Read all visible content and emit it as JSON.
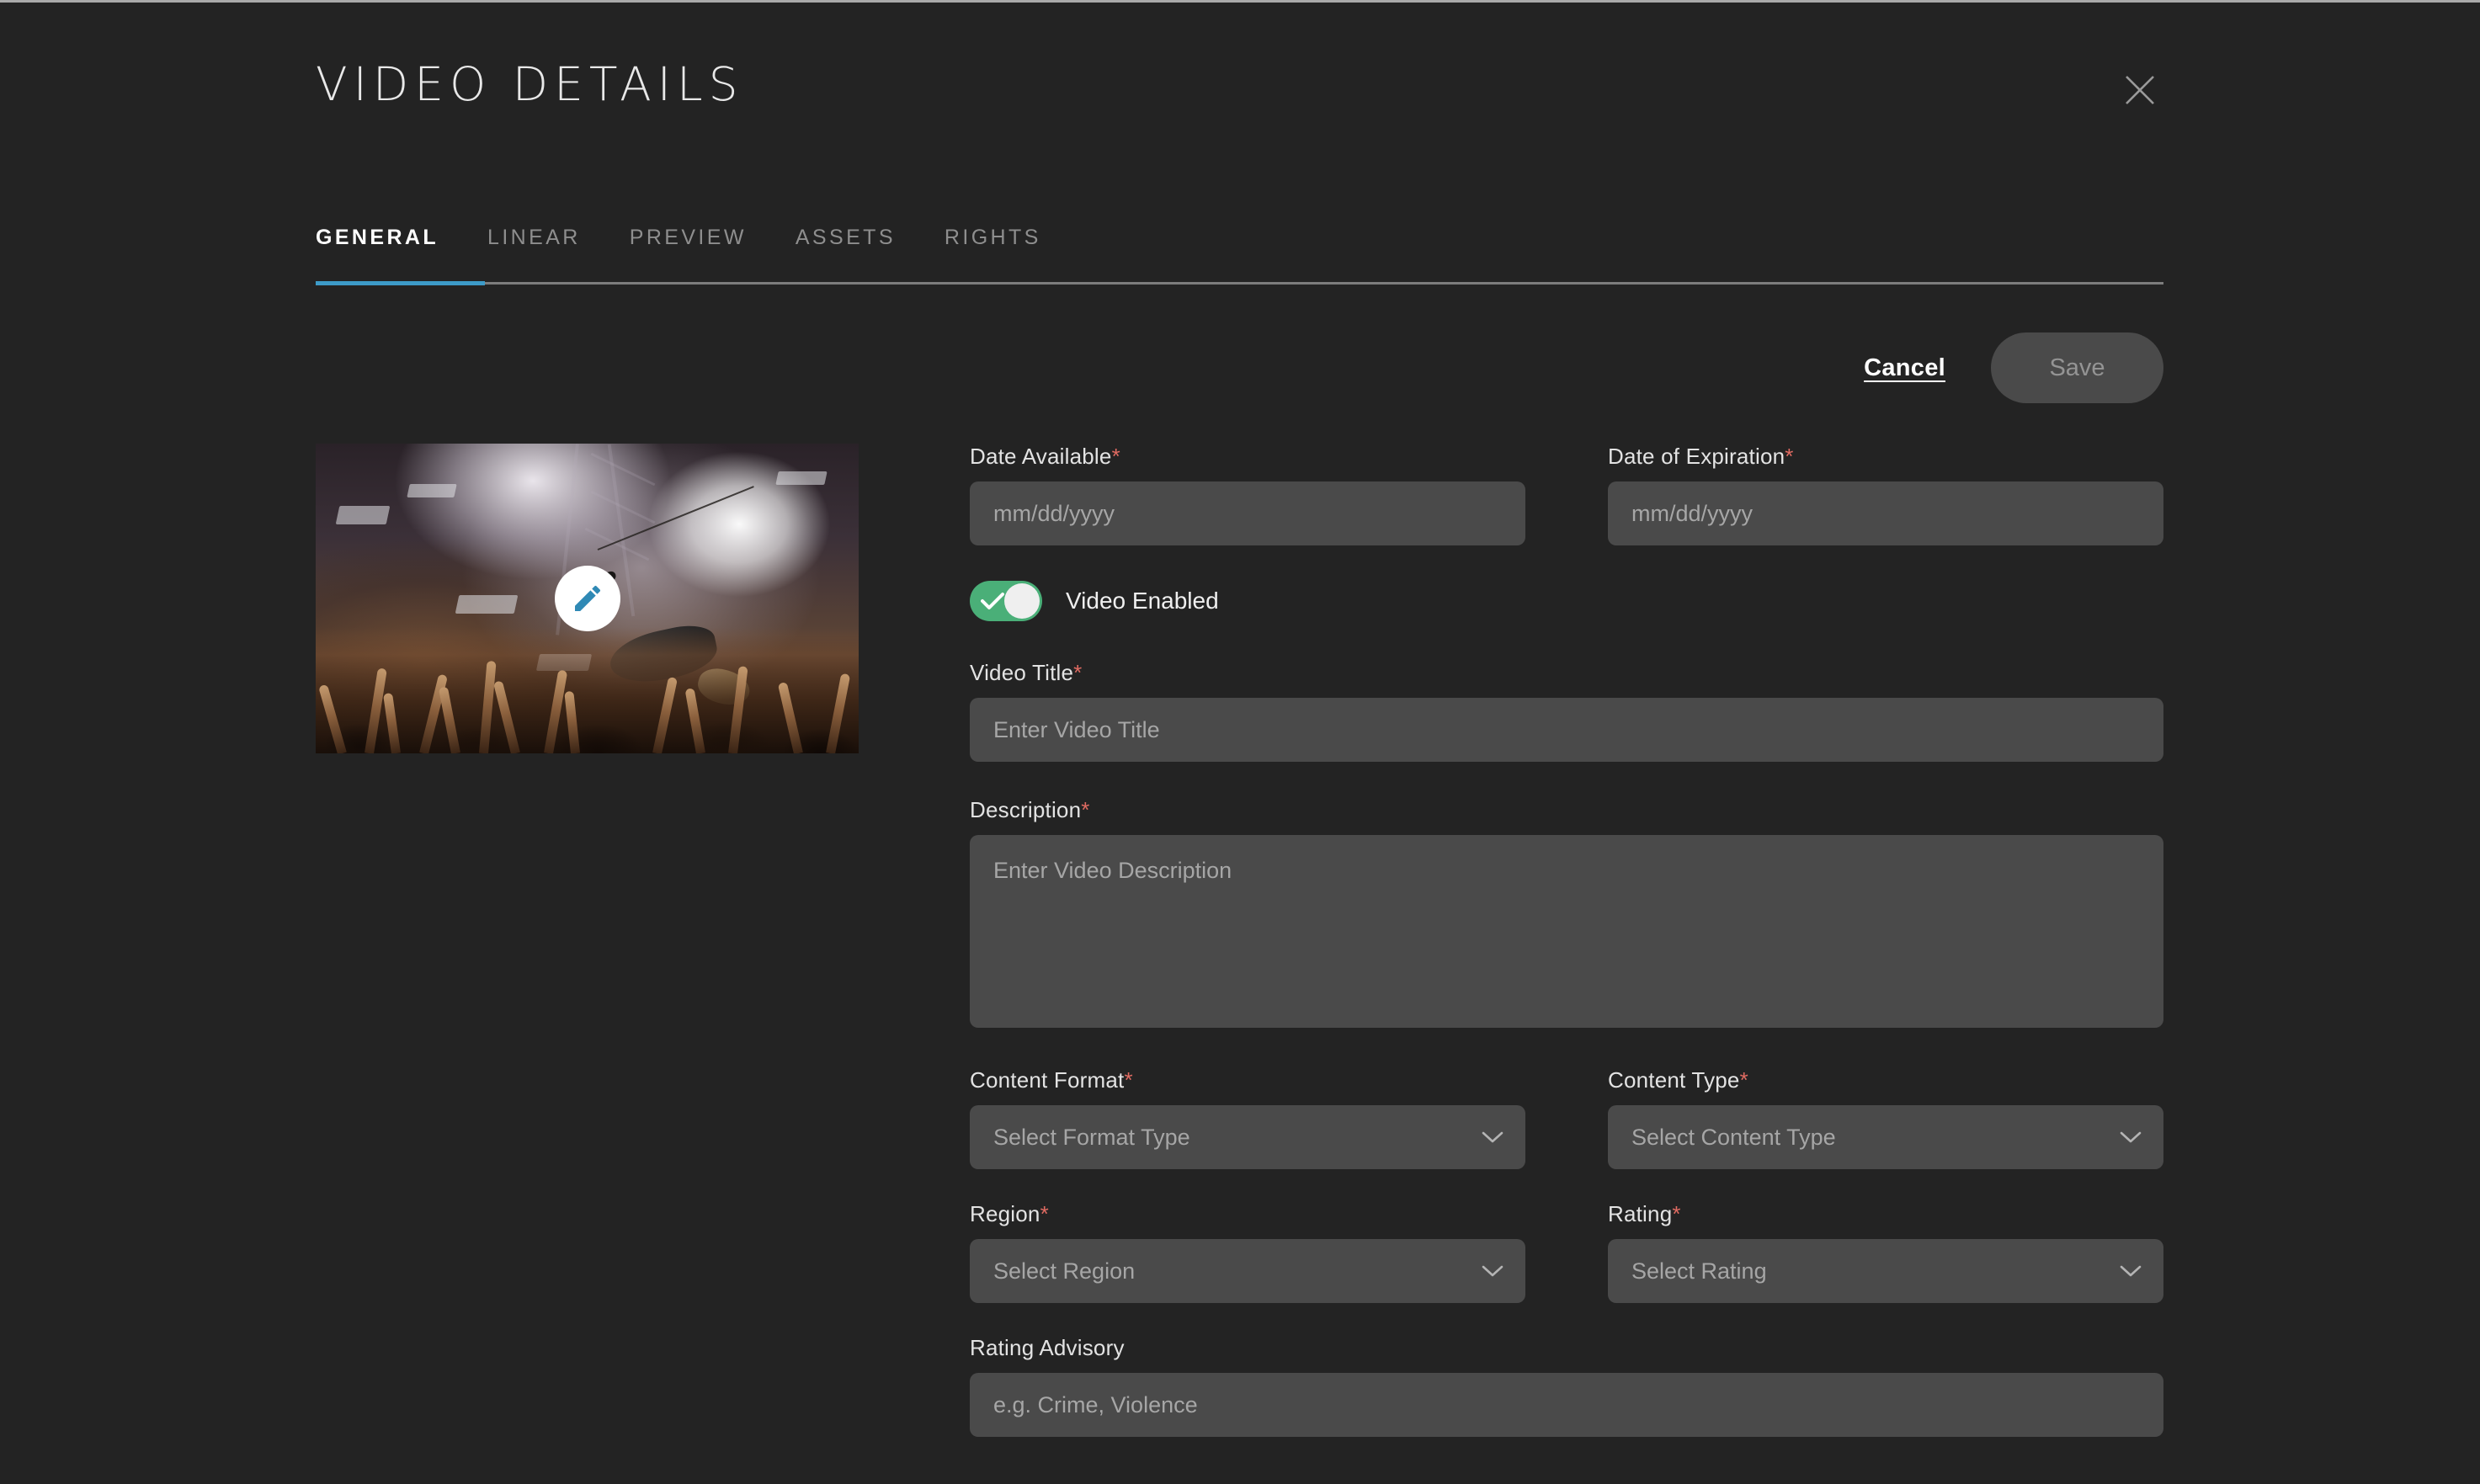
{
  "header": {
    "title": "VIDEO DETAILS",
    "close_icon": "close-icon"
  },
  "tabs": [
    {
      "label": "GENERAL",
      "active": true
    },
    {
      "label": "LINEAR",
      "active": false
    },
    {
      "label": "PREVIEW",
      "active": false
    },
    {
      "label": "ASSETS",
      "active": false
    },
    {
      "label": "RIGHTS",
      "active": false
    }
  ],
  "actions": {
    "cancel_label": "Cancel",
    "save_label": "Save"
  },
  "thumbnail": {
    "edit_icon": "pencil-icon",
    "alt": "Concert crowd surfing performer with stage lights and haze"
  },
  "form": {
    "date_available": {
      "label": "Date Available",
      "required": "*",
      "placeholder": "mm/dd/yyyy",
      "value": ""
    },
    "date_expiration": {
      "label": "Date of Expiration",
      "required": "*",
      "placeholder": "mm/dd/yyyy",
      "value": ""
    },
    "video_enabled": {
      "label": "Video Enabled",
      "state": "on"
    },
    "video_title": {
      "label": "Video Title",
      "required": "*",
      "placeholder": "Enter Video Title",
      "value": ""
    },
    "description": {
      "label": "Description",
      "required": "*",
      "placeholder": "Enter Video Description",
      "value": ""
    },
    "content_format": {
      "label": "Content Format",
      "required": "*",
      "placeholder": "Select Format Type",
      "value": ""
    },
    "content_type": {
      "label": "Content Type",
      "required": "*",
      "placeholder": "Select Content Type",
      "value": ""
    },
    "region": {
      "label": "Region",
      "required": "*",
      "placeholder": "Select Region",
      "value": ""
    },
    "rating": {
      "label": "Rating",
      "required": "*",
      "placeholder": "Select Rating",
      "value": ""
    },
    "rating_advisory": {
      "label": "Rating Advisory",
      "required": "",
      "placeholder": "e.g. Crime, Violence",
      "value": ""
    }
  },
  "colors": {
    "background": "#232323",
    "field_background": "#4a4a4a",
    "accent_blue": "#3d9bc8",
    "toggle_green": "#4aaf78",
    "required_red": "#e06b62",
    "save_disabled": "#4a4a4a"
  }
}
